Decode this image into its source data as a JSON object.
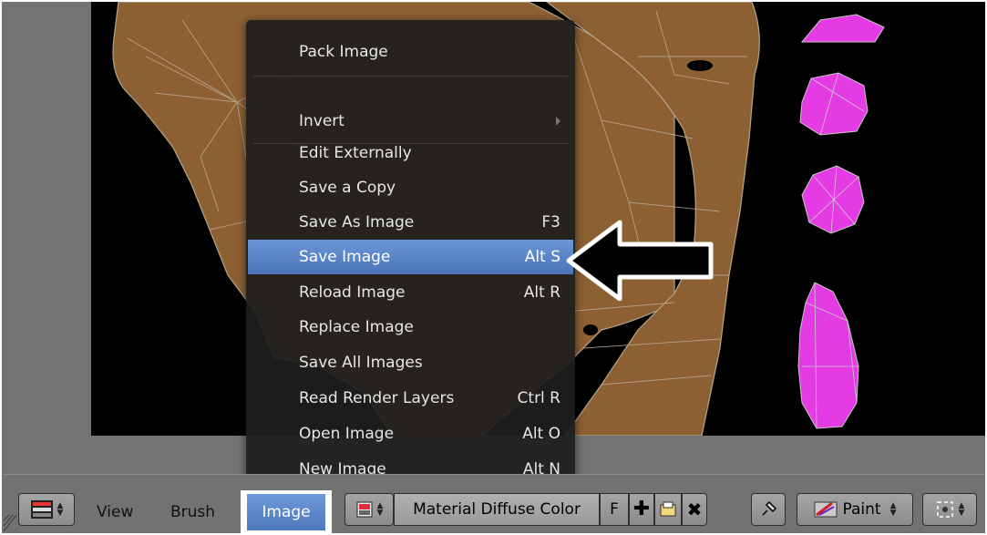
{
  "menu": {
    "items": [
      {
        "label": "Pack Image",
        "shortcut": ""
      },
      {
        "label": "Invert",
        "shortcut": ""
      },
      {
        "label": "Edit Externally",
        "shortcut": ""
      },
      {
        "label": "Save a Copy",
        "shortcut": ""
      },
      {
        "label": "Save As Image",
        "shortcut": "F3"
      },
      {
        "label": "Save Image",
        "shortcut": "Alt S"
      },
      {
        "label": "Reload Image",
        "shortcut": "Alt R"
      },
      {
        "label": "Replace Image",
        "shortcut": ""
      },
      {
        "label": "Save All Images",
        "shortcut": ""
      },
      {
        "label": "Read Render Layers",
        "shortcut": "Ctrl R"
      },
      {
        "label": "Open Image",
        "shortcut": "Alt O"
      },
      {
        "label": "New Image",
        "shortcut": "Alt N"
      }
    ],
    "highlighted": "Save Image"
  },
  "header": {
    "view_label": "View",
    "brush_label": "Brush",
    "image_label": "Image",
    "image_field": "Material Diffuse Color",
    "fake_user": "F",
    "mode_label": "Paint"
  },
  "colors": {
    "mesh_fill": "#8d6033",
    "island_fill": "#e53be5",
    "highlight": "#5a86cc",
    "background": "#000000"
  },
  "icons": [
    "editor-type-icon",
    "image-browse-icon",
    "new-image-icon",
    "open-image-icon",
    "unlink-icon",
    "pin-icon",
    "paint-brush-icon",
    "snap-icon",
    "submenu-arrow-icon",
    "callout-arrow-icon"
  ]
}
